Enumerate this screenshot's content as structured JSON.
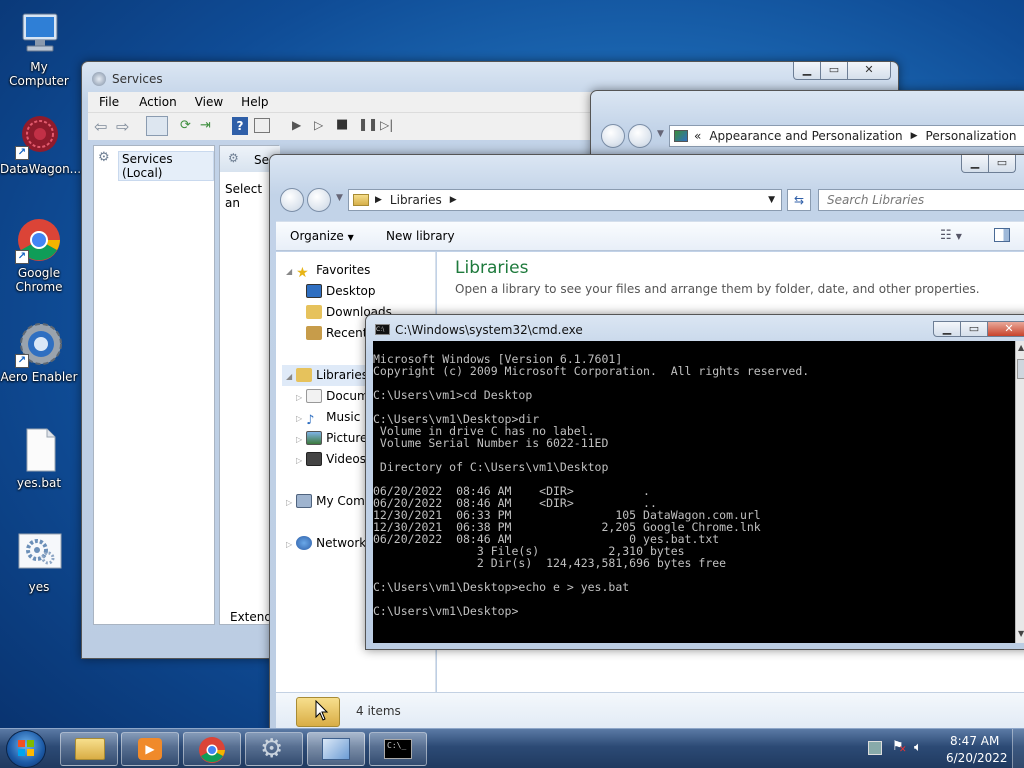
{
  "desktop": {
    "icons": [
      {
        "label": "My Computer",
        "icon": "computer-icon"
      },
      {
        "label": "DataWagon...",
        "icon": "datawagon-icon"
      },
      {
        "label": "Google Chrome",
        "icon": "chrome-icon"
      },
      {
        "label": "Aero Enabler",
        "icon": "aero-enabler-icon"
      },
      {
        "label": "yes.bat",
        "icon": "batch-file-icon"
      },
      {
        "label": "yes",
        "icon": "gear-file-icon"
      }
    ]
  },
  "services_window": {
    "title": "Services",
    "menu": [
      "File",
      "Action",
      "View",
      "Help"
    ],
    "tree_root": "Services (Local)",
    "panel_header": "Ser",
    "panel_text": "Select an",
    "tab_extended": "Extende"
  },
  "personalization_window": {
    "breadcrumb": [
      "Appearance and Personalization",
      "Personalization"
    ]
  },
  "explorer_window": {
    "address_path": "Libraries",
    "search_placeholder": "Search Libraries",
    "toolbar": {
      "organize": "Organize",
      "new_library": "New library"
    },
    "nav": {
      "favorites": "Favorites",
      "desktop": "Desktop",
      "downloads": "Downloads",
      "recent": "Recent",
      "libraries": "Libraries",
      "documents": "Docum",
      "music": "Music",
      "pictures": "Picture",
      "videos": "Videos",
      "computer": "My Com",
      "network": "Network"
    },
    "heading": "Libraries",
    "subheading": "Open a library to see your files and arrange them by folder, date, and other properties.",
    "status": "4 items"
  },
  "cmd_window": {
    "title": "C:\\Windows\\system32\\cmd.exe",
    "lines": [
      "Microsoft Windows [Version 6.1.7601]",
      "Copyright (c) 2009 Microsoft Corporation.  All rights reserved.",
      "",
      "C:\\Users\\vm1>cd Desktop",
      "",
      "C:\\Users\\vm1\\Desktop>dir",
      " Volume in drive C has no label.",
      " Volume Serial Number is 6022-11ED",
      "",
      " Directory of C:\\Users\\vm1\\Desktop",
      "",
      "06/20/2022  08:46 AM    <DIR>          .",
      "06/20/2022  08:46 AM    <DIR>          ..",
      "12/30/2021  06:33 PM               105 DataWagon.com.url",
      "12/30/2021  06:38 PM             2,205 Google Chrome.lnk",
      "06/20/2022  08:46 AM                 0 yes.bat.txt",
      "               3 File(s)          2,310 bytes",
      "               2 Dir(s)  124,423,581,696 bytes free",
      "",
      "C:\\Users\\vm1\\Desktop>echo e > yes.bat",
      "",
      "C:\\Users\\vm1\\Desktop>"
    ]
  },
  "taskbar": {
    "apps": [
      "explorer-icon",
      "media-player-icon",
      "chrome-icon",
      "services-icon",
      "control-panel-icon",
      "cmd-icon"
    ],
    "clock_time": "8:47 AM",
    "clock_date": "6/20/2022"
  }
}
